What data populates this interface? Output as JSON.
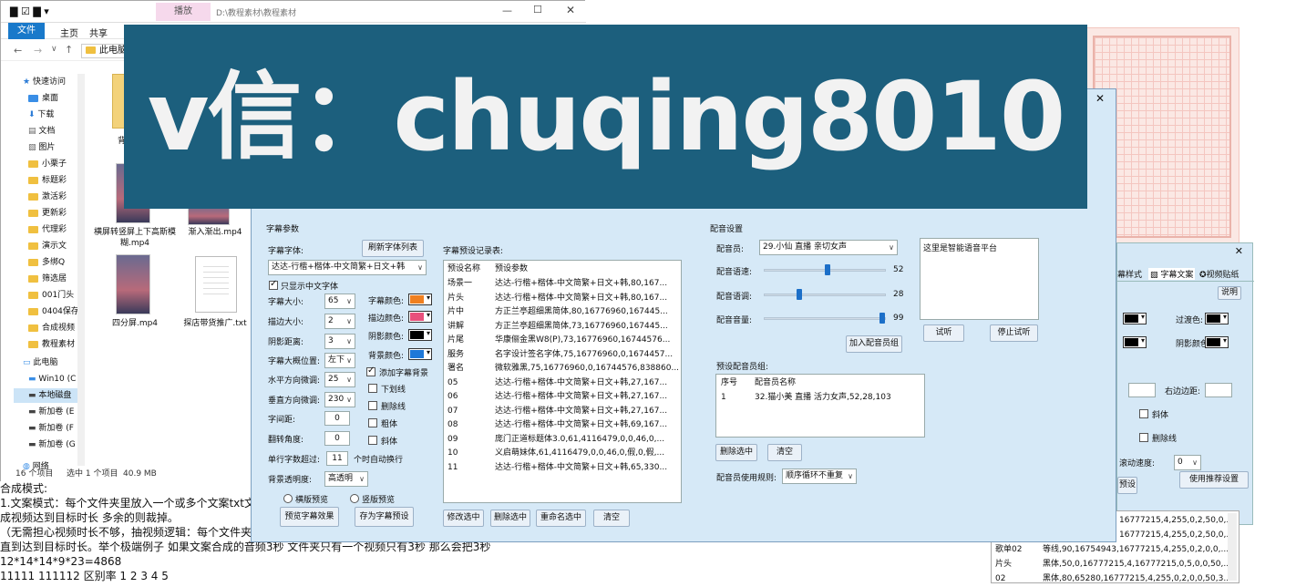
{
  "explorer": {
    "tab_replay": "播放",
    "path_title": "D:\\教程素材\\教程素材",
    "ribbon": [
      "文件",
      "主页",
      "共享"
    ],
    "breadcrumb": "此电脑",
    "sidebar": [
      "快速访问",
      "桌面",
      "下载",
      "文档",
      "图片",
      "小栗子",
      "标题彩",
      "激活彩",
      "更新彩",
      "代理彩",
      "演示文",
      "多绑Q",
      "筛选居",
      "001门头",
      "0404保存",
      "合成视频",
      "教程素材",
      "此电脑",
      "Win10 (C",
      "本地磁盘",
      "新加卷 (E",
      "新加卷 (F",
      "新加卷 (G",
      "网络"
    ],
    "files": [
      {
        "name": "横屏转竖屏上下高斯模糊.mp4"
      },
      {
        "name": "渐入渐出.mp4"
      },
      {
        "name": "四分屏.mp4"
      },
      {
        "name": "探店带货推广.txt"
      }
    ],
    "top_file_partial": "背",
    "status": {
      "count": "16 个项目",
      "selected": "选中 1 个项目",
      "size": "40.9 MB"
    }
  },
  "banner": {
    "text": "v信：chuqing8010"
  },
  "dialog": {
    "subtitle_section": "字幕参数",
    "font_label": "字幕字体:",
    "refresh_fonts": "刷新字体列表",
    "font_value": "达达-行楷+楷体-中文简繁+日文+韩",
    "only_chinese": "只显示中文字体",
    "font_size_label": "字幕大小:",
    "font_size": "65",
    "stroke_size_label": "描边大小:",
    "stroke_size": "2",
    "shadow_dist_label": "阴影距离:",
    "shadow_dist": "3",
    "position_label": "字幕大概位置:",
    "position": "左下",
    "h_offset_label": "水平方向微调:",
    "h_offset": "25",
    "v_offset_label": "垂直方向微调:",
    "v_offset": "230",
    "spacing_label": "字间距:",
    "spacing": "0",
    "rotate_label": "翻转角度:",
    "rotate": "0",
    "wrap_label": "单行字数超过:",
    "wrap": "11",
    "wrap_suffix": "个时自动换行",
    "bg_alpha_label": "背景透明度:",
    "bg_alpha": "高透明",
    "font_color_label": "字幕颜色:",
    "stroke_color_label": "描边颜色:",
    "shadow_color_label": "阴影颜色:",
    "bg_color_label": "背景颜色:",
    "colors": {
      "font": "#f08020",
      "stroke": "#e8507c",
      "shadow": "#000000",
      "bg": "#1e78d8"
    },
    "checks": [
      "添加字幕背景",
      "下划线",
      "删除线",
      "粗体",
      "斜体"
    ],
    "landscape": "横版预览",
    "portrait": "竖版预览",
    "preview_btn": "预览字幕效果",
    "save_btn": "存为字幕预设",
    "preset_table_title": "字幕预设记录表:",
    "preset_headers": [
      "预设名称",
      "预设参数"
    ],
    "presets": [
      [
        "场景一",
        "达达-行楷+楷体-中文简繁+日文+韩,80,167..."
      ],
      [
        "片头",
        "达达-行楷+楷体-中文简繁+日文+韩,80,167..."
      ],
      [
        "片中",
        "方正兰亭超细黑简体,80,16776960,167445..."
      ],
      [
        "讲解",
        "方正兰亭超细黑简体,73,16776960,167445..."
      ],
      [
        "片尾",
        "华康俪金黑W8(P),73,16776960,16744576..."
      ],
      [
        "服务",
        "名字设计签名字体,75,16776960,0,1674457..."
      ],
      [
        "署名",
        "微软雅黑,75,16776960,0,16744576,838860..."
      ],
      [
        "05",
        "达达-行楷+楷体-中文简繁+日文+韩,27,167..."
      ],
      [
        "06",
        "达达-行楷+楷体-中文简繁+日文+韩,27,167..."
      ],
      [
        "07",
        "达达-行楷+楷体-中文简繁+日文+韩,27,167..."
      ],
      [
        "08",
        "达达-行楷+楷体-中文简繁+日文+韩,69,167..."
      ],
      [
        "09",
        "庞门正道标题体3.0,61,4116479,0,0,46,0,..."
      ],
      [
        "10",
        "义启萌妹体,61,4116479,0,0,46,0,假,0,假,..."
      ],
      [
        "11",
        "达达-行楷+楷体-中文简繁+日文+韩,65,330..."
      ]
    ],
    "edit_btn": "修改选中",
    "delete_btn": "删除选中",
    "rename_btn": "重命名选中",
    "clear_btn": "清空",
    "voice_section": "配音设置",
    "voice_label": "配音员:",
    "voice_value": "29.小仙 直播 亲切女声",
    "speed_label": "配音语速:",
    "speed": "52",
    "pitch_label": "配音语调:",
    "pitch": "28",
    "volume_label": "配音音量:",
    "volume": "99",
    "voice_text": "这里是智能语音平台",
    "listen_btn": "试听",
    "stop_btn": "停止试听",
    "add_voice_btn": "加入配音员组",
    "voice_group_title": "预设配音员组:",
    "group_headers": [
      "序号",
      "配音员名称"
    ],
    "group_rows": [
      [
        "1",
        "32.猫小美 直播 活力女声,52,28,103"
      ]
    ],
    "group_delete": "删除选中",
    "group_clear": "清空",
    "rule_label": "配音员使用规则:",
    "rule_value": "顺序循环不重复"
  },
  "right_panel": {
    "tabs": [
      "幕样式",
      "字幕文案",
      "视频贴纸"
    ],
    "explain": "说明",
    "transition_color": "过渡色:",
    "shadow_color": "阴影颜色:",
    "right_margin": "右边边距:",
    "italic": "斜体",
    "strike": "删除线",
    "scroll_speed": "滚动速度:",
    "scroll_value": "0",
    "preset_btn": "预设",
    "use_recommend": "使用推荐设置",
    "list_rows": [
      [
        "",
        "16777215,4,255,0,2,50,0,..."
      ],
      [
        "",
        "16777215,4,255,0,2,50,0,..."
      ],
      [
        "歌单02",
        "等线,90,16754943,16777215,4,255,0,2,0,0,..."
      ],
      [
        "片头",
        "黑体,50,0,16777215,4,16777215,0,5,0,0,50,..."
      ],
      [
        "02",
        "黑体,80,65280,16777215,4,255,0,2,0,0,50,3..."
      ]
    ]
  },
  "bottom_doc": {
    "lines": [
      "合成模式:",
      "1.文案模式：每个文件夹里放入一个或多个文案txt文",
      "成视频达到目标时长 多余的则裁掉。",
      "（无需担心视频时长不够，抽视频逻辑：每个文件夹先",
      "直到达到目标时长。举个极端例子 如果文案合成的音频3秒 文件夹只有一个视频只有3秒 那么会把3秒",
      "12*14*14*9*23=4868",
      "11111  111112 区别率  1 2 3 4 5"
    ]
  }
}
